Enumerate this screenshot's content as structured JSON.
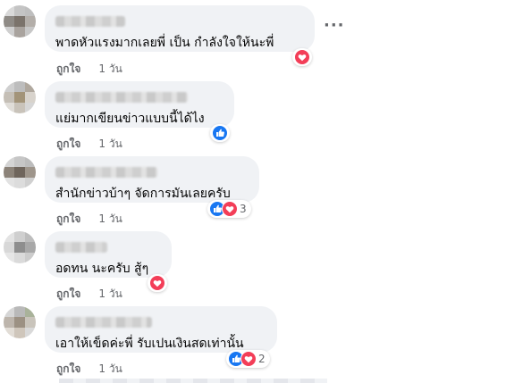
{
  "comments": [
    {
      "text": "พาดหัวแรงมากเลยพี่ เป็น กำลังใจให้นะพี่",
      "like_label": "ถูกใจ",
      "time": "1 วัน",
      "reactions": [
        "love"
      ],
      "reaction_count": "",
      "avatar_colors": [
        "#d9d9d9",
        "#c4c4c4",
        "#bfbfbf",
        "#8f8b86",
        "#7b736b",
        "#b3aea9",
        "#cfcfcf",
        "#a9a39e",
        "#c7c7c7"
      ]
    },
    {
      "text": "แย่มากเขียนข่าวแบบนี้ได้ไง",
      "like_label": "ถูกใจ",
      "time": "1 วัน",
      "reactions": [
        "like"
      ],
      "reaction_count": "",
      "avatar_colors": [
        "#cfcfcf",
        "#bdbdbd",
        "#b0a89e",
        "#c5bfb6",
        "#a39479",
        "#d8d3cc",
        "#e0ddd8",
        "#c9c3ba",
        "#d6d6d6"
      ]
    },
    {
      "text": "สำนักข่าวบ้าๆ จัดการมันเลยครับ",
      "like_label": "ถูกใจ",
      "time": "1 วัน",
      "reactions": [
        "like",
        "love"
      ],
      "reaction_count": "3",
      "avatar_colors": [
        "#d4d4d4",
        "#c6c6c6",
        "#bdbdbd",
        "#8c8379",
        "#6f655c",
        "#9e958b",
        "#e2e2e2",
        "#dcdcdc",
        "#d0d0d0"
      ]
    },
    {
      "text": "อดทน นะครับ สู้ๆ",
      "like_label": "ถูกใจ",
      "time": "1 วัน",
      "reactions": [
        "love"
      ],
      "reaction_count": "",
      "avatar_colors": [
        "#e3e3e3",
        "#cfcfcf",
        "#bdbdbd",
        "#d8d8d8",
        "#8e8e8e",
        "#a8a8a8",
        "#e6e6e6",
        "#dadada",
        "#cccccc"
      ]
    },
    {
      "text": "เอาให้เข็ดค่ะพี่ รับเปนเงินสดเท่านั้น",
      "like_label": "ถูกใจ",
      "time": "1 วัน",
      "reactions": [
        "like",
        "love"
      ],
      "reaction_count": "2",
      "avatar_colors": [
        "#d6d6d6",
        "#b9b9b9",
        "#a9b29a",
        "#bdb5ac",
        "#9c9183",
        "#c9c4bb",
        "#e2ddd6",
        "#cfc6bb",
        "#d9d9d9"
      ]
    }
  ],
  "more_label": "···",
  "colors": {
    "bubble": "#f0f2f5",
    "like_blue": "#1877f2",
    "love_red": "#f33e58",
    "meta_gray": "#65676b"
  },
  "icons": [
    "like-icon",
    "love-icon",
    "more-options-icon"
  ]
}
